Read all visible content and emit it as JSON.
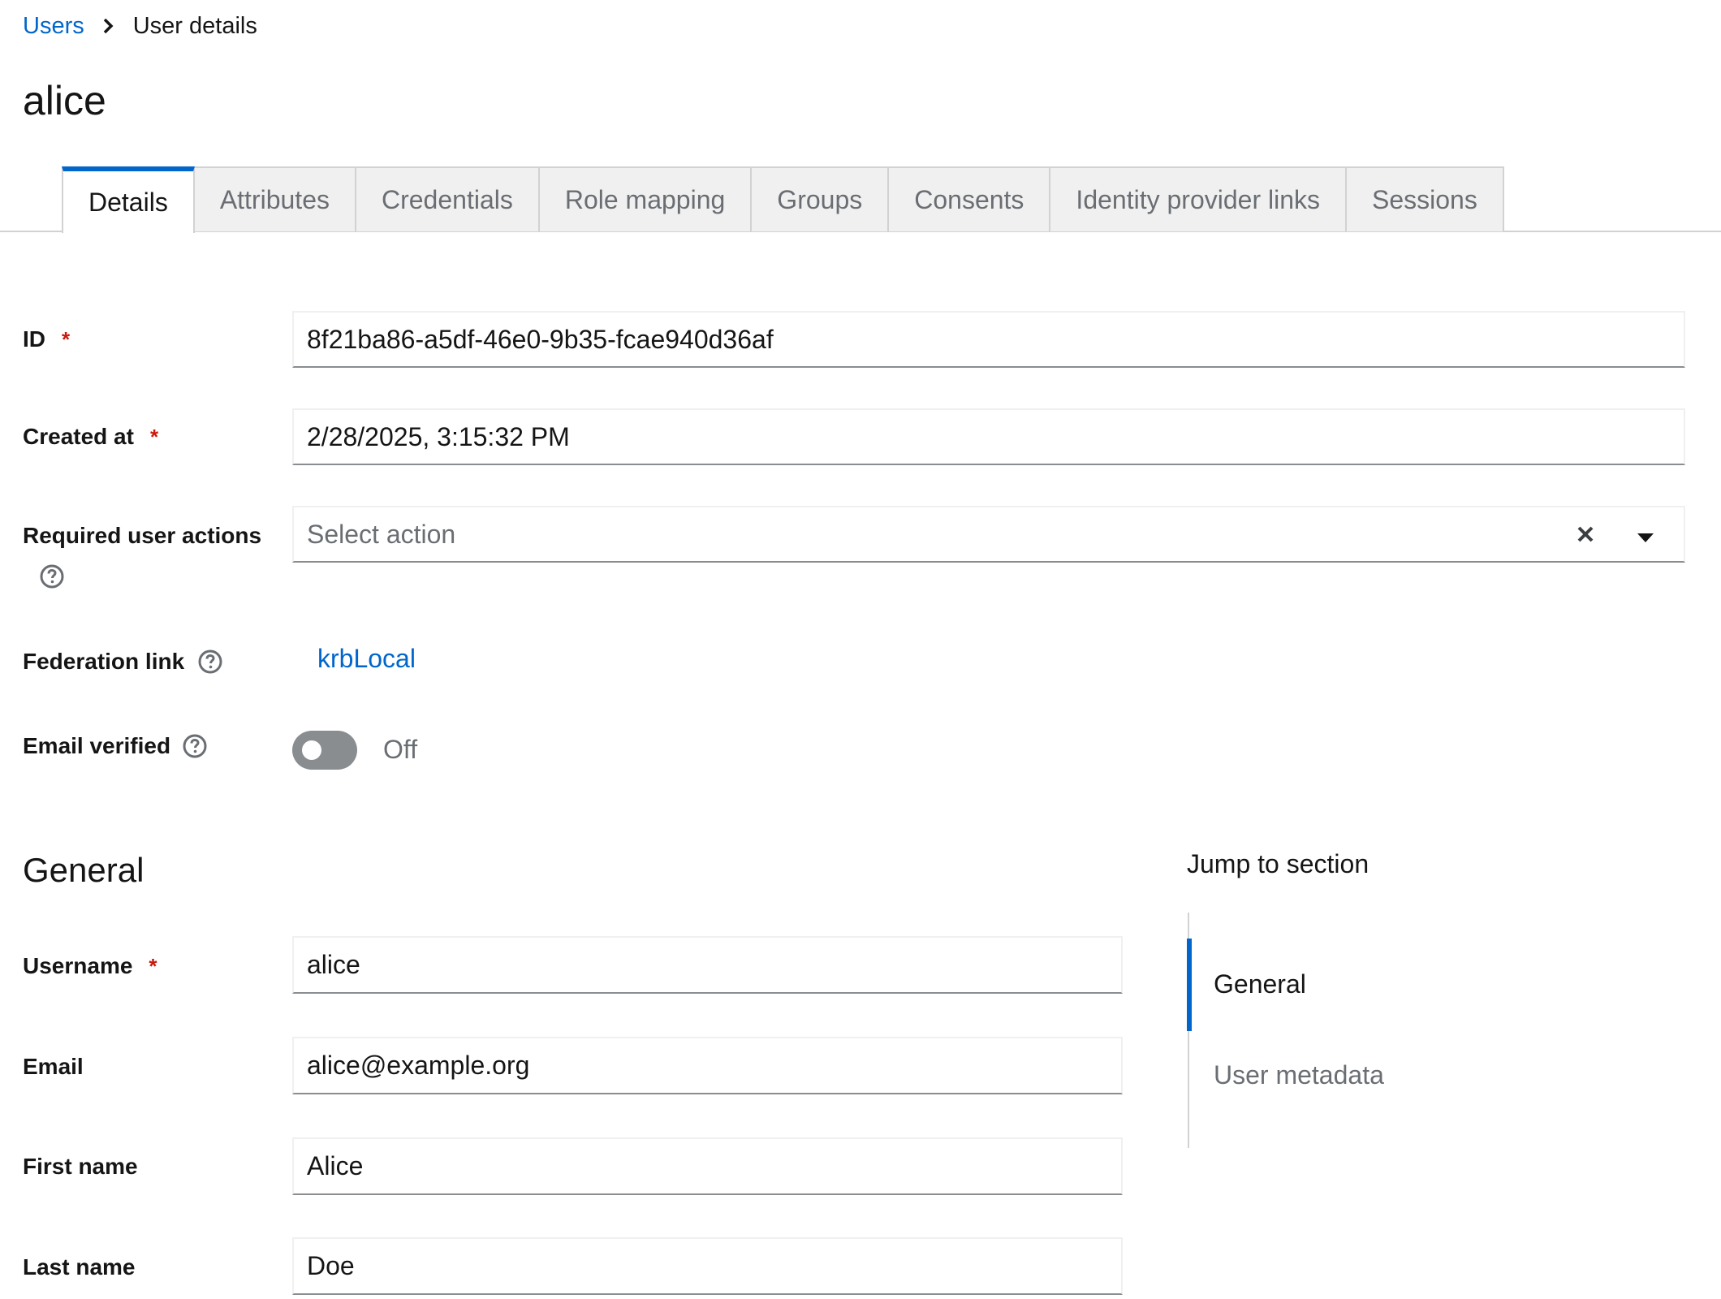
{
  "breadcrumb": {
    "parent": "Users",
    "current": "User details"
  },
  "page_title": "alice",
  "tabs": [
    {
      "label": "Details",
      "active": true
    },
    {
      "label": "Attributes"
    },
    {
      "label": "Credentials"
    },
    {
      "label": "Role mapping"
    },
    {
      "label": "Groups"
    },
    {
      "label": "Consents"
    },
    {
      "label": "Identity provider links"
    },
    {
      "label": "Sessions"
    }
  ],
  "form": {
    "id": {
      "label": "ID",
      "required_mark": "*",
      "value": "8f21ba86-a5df-46e0-9b35-fcae940d36af"
    },
    "created_at": {
      "label": "Created at",
      "required_mark": "*",
      "value": "2/28/2025, 3:15:32 PM"
    },
    "required_actions": {
      "label": "Required user actions",
      "placeholder": "Select action"
    },
    "federation_link": {
      "label": "Federation link",
      "value": "krbLocal"
    },
    "email_verified": {
      "label": "Email verified",
      "state": "Off"
    }
  },
  "general": {
    "title": "General",
    "username": {
      "label": "Username",
      "required_mark": "*",
      "value": "alice"
    },
    "email": {
      "label": "Email",
      "value": "alice@example.org"
    },
    "first_name": {
      "label": "First name",
      "value": "Alice"
    },
    "last_name": {
      "label": "Last name",
      "value": "Doe"
    }
  },
  "jump": {
    "title": "Jump to section",
    "items": [
      {
        "label": "General",
        "active": true
      },
      {
        "label": "User metadata"
      }
    ]
  },
  "colors": {
    "link": "#0066cc",
    "required": "#c9190b",
    "tab_active_border": "#0066cc",
    "toggle_off": "#8a8d90"
  },
  "icons": {
    "breadcrumb_separator": "chevron-right-icon",
    "help": "question-circle-icon",
    "clear": "times-icon",
    "dropdown": "caret-down-icon"
  }
}
